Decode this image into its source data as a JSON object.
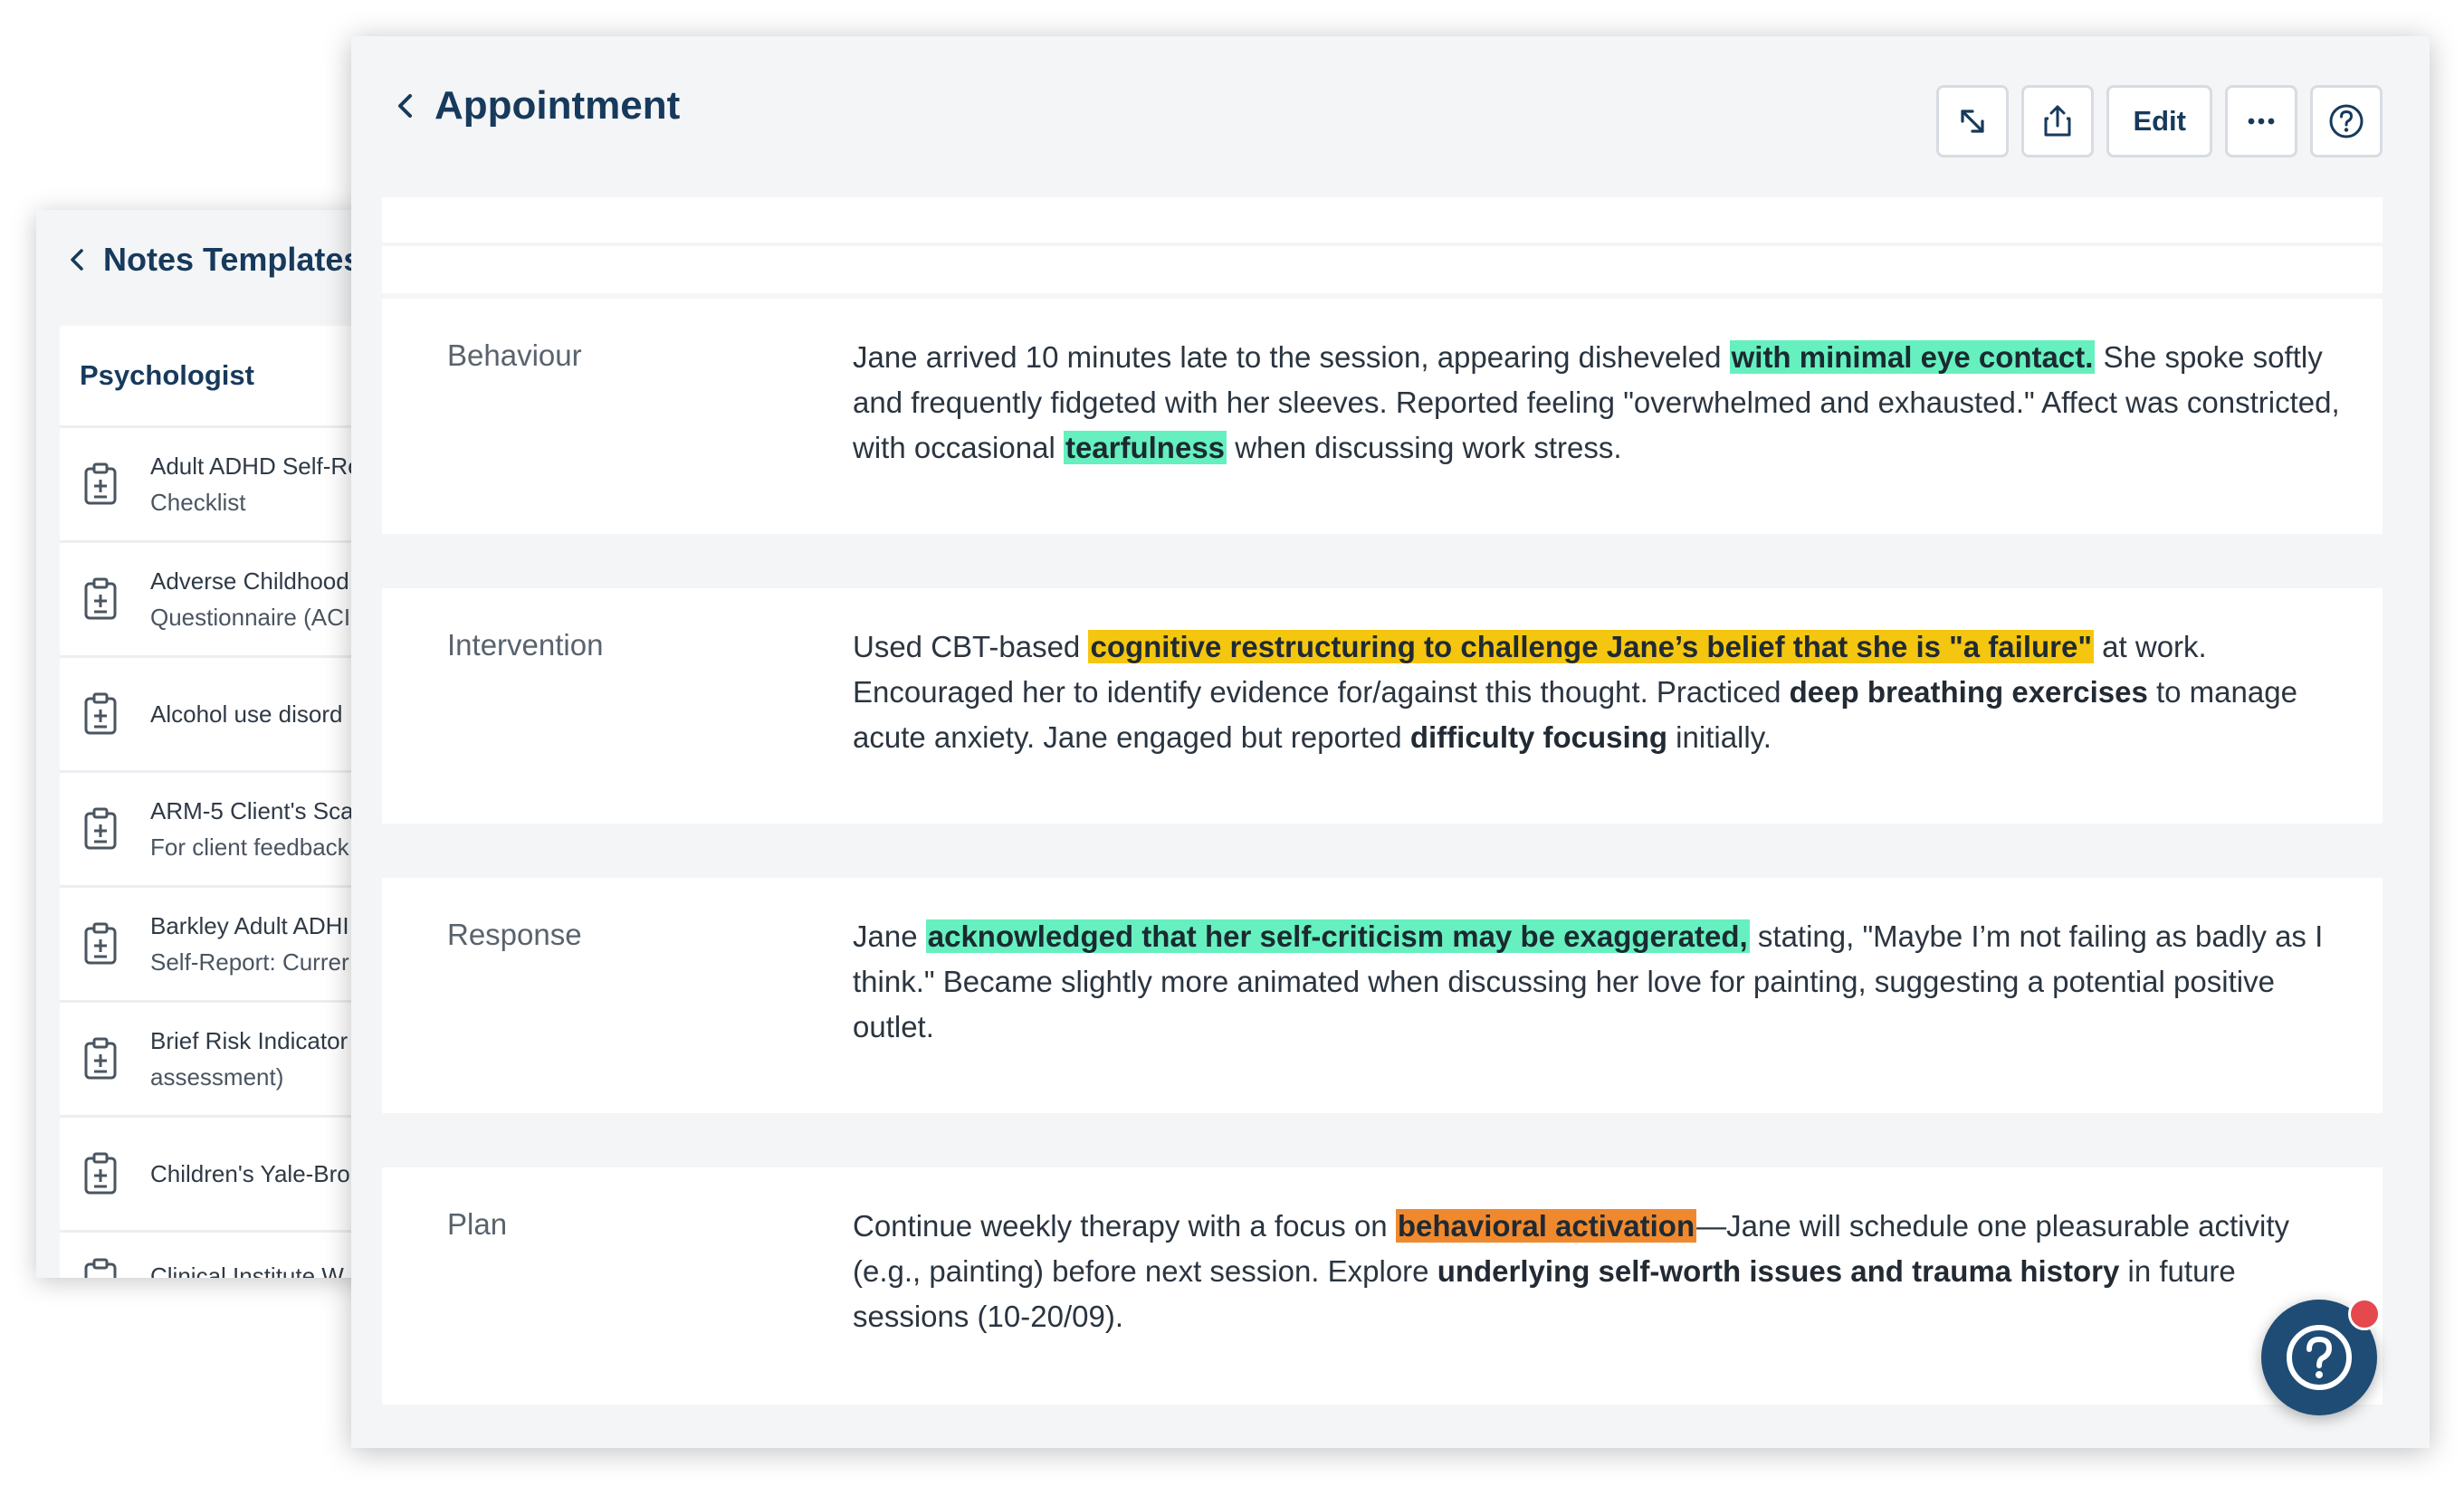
{
  "notes_templates": {
    "title": "Notes Templates",
    "category": "Psychologist",
    "items": [
      {
        "line1": "Adult ADHD Self-Re",
        "line2": "Checklist"
      },
      {
        "line1": "Adverse Childhood",
        "line2": "Questionnaire (ACI"
      },
      {
        "line1": "Alcohol use disord",
        "line2": ""
      },
      {
        "line1": "ARM-5 Client's Sca",
        "line2": "For client feedback"
      },
      {
        "line1": "Barkley Adult ADHI",
        "line2": "Self-Report: Currer"
      },
      {
        "line1": "Brief Risk Indicator",
        "line2": "assessment)"
      },
      {
        "line1": "Children's Yale-Bro",
        "line2": ""
      },
      {
        "line1": "Clinical Institute W",
        "line2": ""
      }
    ]
  },
  "appointment": {
    "title": "Appointment",
    "toolbar": {
      "edit_label": "Edit"
    },
    "sections": {
      "behaviour": {
        "label": "Behaviour",
        "t1": "Jane arrived 10 minutes late to the session, appearing disheveled ",
        "h1": "with minimal eye contact.",
        "t2": " She spoke softly and frequently fidgeted with her sleeves. Reported feeling \"overwhelmed and exhausted.\" Affect was constricted, with occasional ",
        "h2": "tearfulness",
        "t3": " when discussing work stress."
      },
      "intervention": {
        "label": "Intervention",
        "t1": "Used CBT-based ",
        "h1": "cognitive restructuring to challenge Jane’s belief that she is \"a failure\"",
        "t2": " at work. Encouraged her to identify evidence for/against this thought. Practiced ",
        "b1": "deep breathing exercises",
        "t3": " to manage acute anxiety. Jane engaged but reported ",
        "b2": "difficulty focusing",
        "t4": " initially."
      },
      "response": {
        "label": "Response",
        "t1": "Jane ",
        "h1": "acknowledged that her self-criticism may be exaggerated,",
        "t2": " stating, \"Maybe I’m not failing as badly as I think.\" Became slightly more animated when discussing her love for painting, suggesting a potential positive outlet."
      },
      "plan": {
        "label": "Plan",
        "t1": "Continue weekly therapy with a focus on ",
        "h1": "behavioral activation",
        "t2": "—Jane will schedule one pleasurable activity (e.g., painting) before next session. Explore ",
        "b1": "underlying self-worth issues and trauma history",
        "t3": " in future sessions (10-20/09)."
      }
    }
  },
  "colors": {
    "title_navy": "#173a5c",
    "highlight_green": "#66f0bf",
    "highlight_yellow": "#f5c60f",
    "highlight_orange": "#f0892e",
    "help_fab": "#1f4c74",
    "notification_dot": "#e5484d"
  },
  "icons": {
    "back": "chevron-left-icon",
    "expand": "expand-arrows-icon",
    "share": "share-icon",
    "more": "more-horizontal-icon",
    "help": "help-circle-icon",
    "template": "clipboard-plus-icon"
  }
}
